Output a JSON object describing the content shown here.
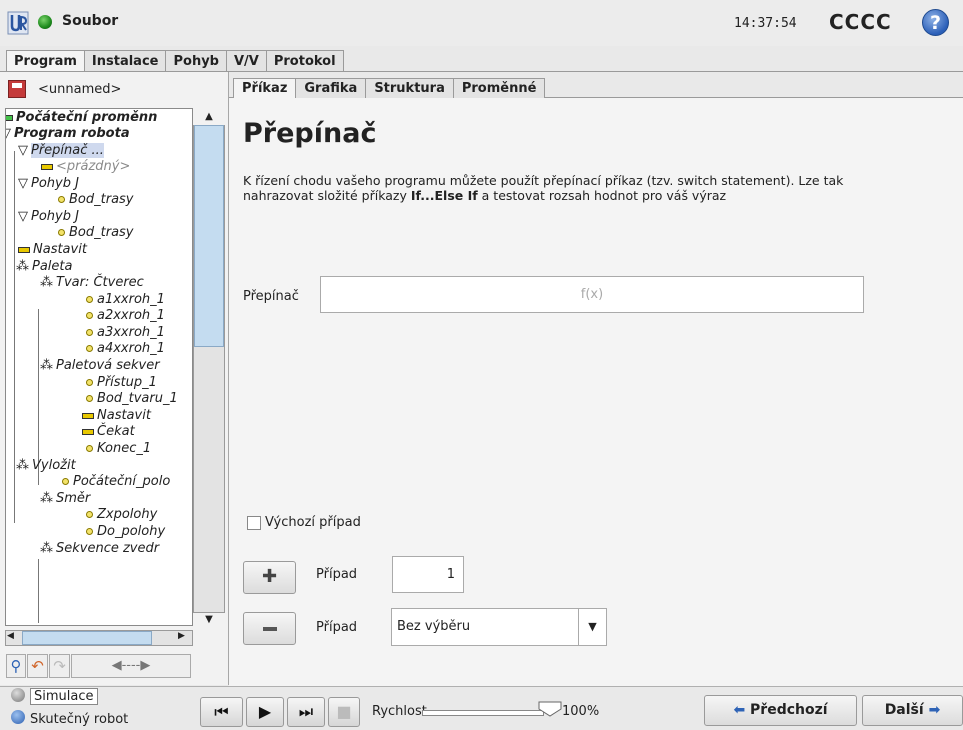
{
  "header": {
    "file_menu": "Soubor",
    "clock": "14:37:54",
    "robot_name": "CCCC",
    "help": "?"
  },
  "main_tabs": [
    "Program",
    "Instalace",
    "Pohyb",
    "V/V",
    "Protokol"
  ],
  "left_panel": {
    "file_name": "<unnamed>",
    "tree": [
      {
        "label": "Počáteční proměnn",
        "icon": "green-bar-icon"
      },
      {
        "label": "Program robota",
        "icon": "triangle-down-icon"
      },
      {
        "label": "Přepínač ...",
        "icon": "triangle-down-icon"
      },
      {
        "label": "<prázdný>",
        "icon": "yellow-bar-icon"
      },
      {
        "label": "Pohyb J",
        "icon": "triangle-down-icon"
      },
      {
        "label": "Bod_trasy",
        "icon": "waypoint-icon"
      },
      {
        "label": "Pohyb J",
        "icon": "triangle-down-icon"
      },
      {
        "label": "Bod_trasy",
        "icon": "waypoint-icon"
      },
      {
        "label": "Nastavit",
        "icon": "yellow-bar-icon"
      },
      {
        "label": "Paleta",
        "icon": "pallet-icon"
      },
      {
        "label": "Tvar: Čtverec",
        "icon": "pallet-icon"
      },
      {
        "label": "a1xxroh_1",
        "icon": "waypoint-icon"
      },
      {
        "label": "a2xxroh_1",
        "icon": "waypoint-icon"
      },
      {
        "label": "a3xxroh_1",
        "icon": "waypoint-icon"
      },
      {
        "label": "a4xxroh_1",
        "icon": "waypoint-icon"
      },
      {
        "label": "Paletová sekver",
        "icon": "pallet-icon"
      },
      {
        "label": "Přístup_1",
        "icon": "waypoint-icon"
      },
      {
        "label": "Bod_tvaru_1",
        "icon": "waypoint-icon"
      },
      {
        "label": "Nastavit",
        "icon": "yellow-bar-icon"
      },
      {
        "label": "Čekat",
        "icon": "yellow-bar-icon"
      },
      {
        "label": "Konec_1",
        "icon": "waypoint-icon"
      },
      {
        "label": "Vyložit",
        "icon": "pallet-icon"
      },
      {
        "label": "Počáteční_polo",
        "icon": "waypoint-icon"
      },
      {
        "label": "Směr",
        "icon": "pallet-icon"
      },
      {
        "label": "Zxpolohy",
        "icon": "waypoint-icon"
      },
      {
        "label": "Do_polohy",
        "icon": "waypoint-icon"
      },
      {
        "label": "Sekvence zvedr",
        "icon": "pallet-icon"
      }
    ]
  },
  "sub_tabs": [
    "Příkaz",
    "Grafika",
    "Struktura",
    "Proměnné"
  ],
  "main": {
    "title": "Přepínač",
    "description_pre": "K řízení chodu vašeho programu můžete použít přepínací příkaz (tzv. switch statement). Lze tak nahrazovat složité příkazy ",
    "description_bold": "If...Else If",
    "description_post": " a testovat rozsah hodnot pro váš výraz",
    "switch_label": "Přepínač",
    "switch_placeholder": "f(x)",
    "default_case_label": "Výchozí případ",
    "case_label": "Případ",
    "case_value": "1",
    "case_select_value": "Bez výběru"
  },
  "bottom": {
    "simulation": "Simulace",
    "real_robot": "Skutečný robot",
    "speed_label": "Rychlost",
    "speed_value": "100%",
    "speed_fraction": 1.0,
    "prev": "Předchozí",
    "next": "Další"
  },
  "colors": {
    "accent_blue": "#2e63b6",
    "selection": "#cfd9ee",
    "scroll_thumb": "#c4dcf0"
  }
}
